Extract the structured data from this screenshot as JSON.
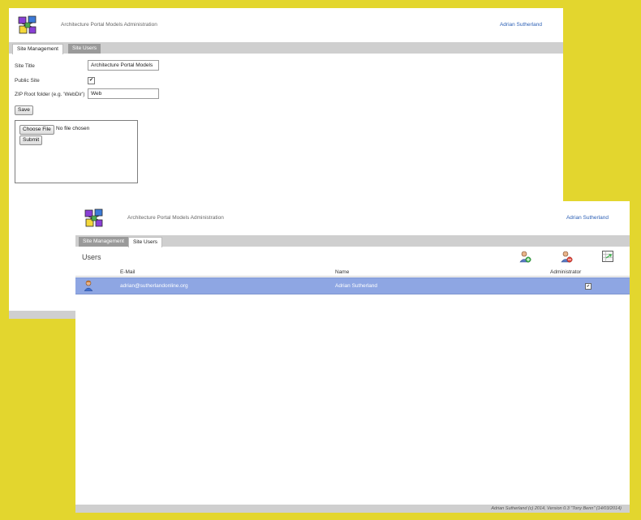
{
  "app": {
    "title": "Architecture Portal Models Administration",
    "user": "Adrian Sutherland"
  },
  "tabs": {
    "site_management": "Site Management",
    "site_users": "Site Users"
  },
  "site_form": {
    "site_title_label": "Site Title",
    "site_title_value": "Architecture Portal Models",
    "public_site_label": "Public Site",
    "public_site_checked": true,
    "zip_root_label": "ZIP Root folder (e.g. 'WebDir')",
    "zip_root_value": "Web",
    "save_label": "Save"
  },
  "upload": {
    "choose_file_label": "Choose File",
    "file_status": "No file chosen",
    "submit_label": "Submit"
  },
  "users": {
    "title": "Users",
    "toolbar_icons": [
      "add-user-icon",
      "remove-user-icon",
      "export-icon"
    ],
    "columns": [
      "E-Mail",
      "Name",
      "Administrator"
    ],
    "rows": [
      {
        "email": "adrian@sutherlandonline.org",
        "name": "Adrian Sutherland",
        "administrator": true
      }
    ]
  },
  "footer": "Adrian Sutherland (c) 2014, Version 0.3 \"Tony Benn\" (14/03/2014)",
  "colors": {
    "background": "#e3d62e",
    "selected_row": "#8ea6e3",
    "tab_bar": "#cfcfcf",
    "link": "#2b5fb5"
  }
}
